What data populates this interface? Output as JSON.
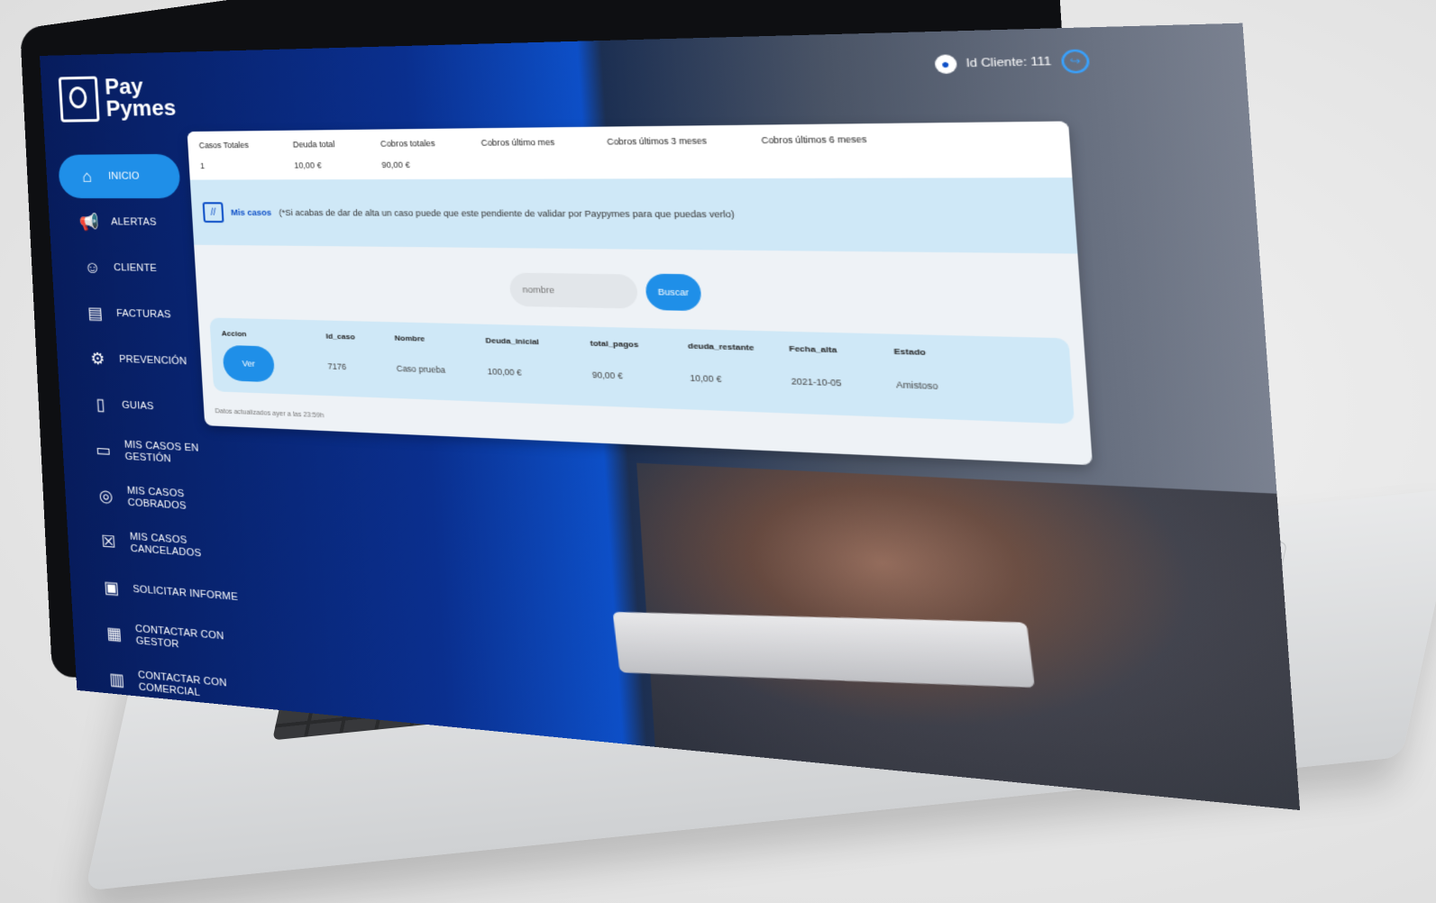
{
  "logo": {
    "line1": "Pay",
    "line2": "Pymes"
  },
  "topbar": {
    "client_id": "Id Cliente: 111"
  },
  "sidebar": {
    "items": [
      {
        "label": "INICIO",
        "icon": "home-icon"
      },
      {
        "label": "ALERTAS",
        "icon": "megaphone-icon"
      },
      {
        "label": "CLIENTE",
        "icon": "user-icon"
      },
      {
        "label": "FACTURAS",
        "icon": "invoice-icon"
      },
      {
        "label": "PREVENCIÓN",
        "icon": "gear-icon"
      },
      {
        "label": "GUIAS",
        "icon": "guide-icon"
      },
      {
        "label": "MIS CASOS EN GESTIÓN",
        "icon": "laptop-icon"
      },
      {
        "label": "MIS CASOS COBRADOS",
        "icon": "coin-hand-icon"
      },
      {
        "label": "MIS CASOS CANCELADOS",
        "icon": "cancel-box-icon"
      },
      {
        "label": "SOLICITAR INFORME",
        "icon": "document-icon"
      },
      {
        "label": "CONTACTAR CON GESTOR",
        "icon": "contact-card-icon"
      },
      {
        "label": "CONTACTAR CON COMERCIAL",
        "icon": "briefcase-icon"
      }
    ]
  },
  "stats": {
    "headers": [
      "Casos Totales",
      "Deuda total",
      "Cobros totales",
      "Cobros último mes",
      "Cobros últimos 3 meses",
      "Cobros últimos 6 meses"
    ],
    "values": [
      "1",
      "10,00 €",
      "90,00 €",
      "",
      "",
      ""
    ]
  },
  "notice": {
    "title": "Mis casos",
    "text": "(*Si acabas de dar de alta un caso puede que este pendiente de validar por Paypymes para que puedas verlo)"
  },
  "search": {
    "placeholder": "nombre",
    "button_label": "Buscar"
  },
  "table": {
    "headers": [
      "Accion",
      "Id_caso",
      "Nombre",
      "Deuda_inicial",
      "total_pagos",
      "deuda_restante",
      "Fecha_alta",
      "Estado"
    ],
    "rows": [
      {
        "action": "Ver",
        "id_caso": "7176",
        "nombre": "Caso prueba",
        "deuda_inicial": "100,00 €",
        "total_pagos": "90,00 €",
        "deuda_restante": "10,00 €",
        "fecha_alta": "2021-10-05",
        "estado": "Amistoso"
      }
    ]
  },
  "footer": {
    "note": "Datos actualizados ayer a las 23:59h"
  },
  "colors": {
    "accent": "#1f8fe8",
    "brand": "#0d4fc7",
    "panel_light": "#cfe8f7"
  }
}
